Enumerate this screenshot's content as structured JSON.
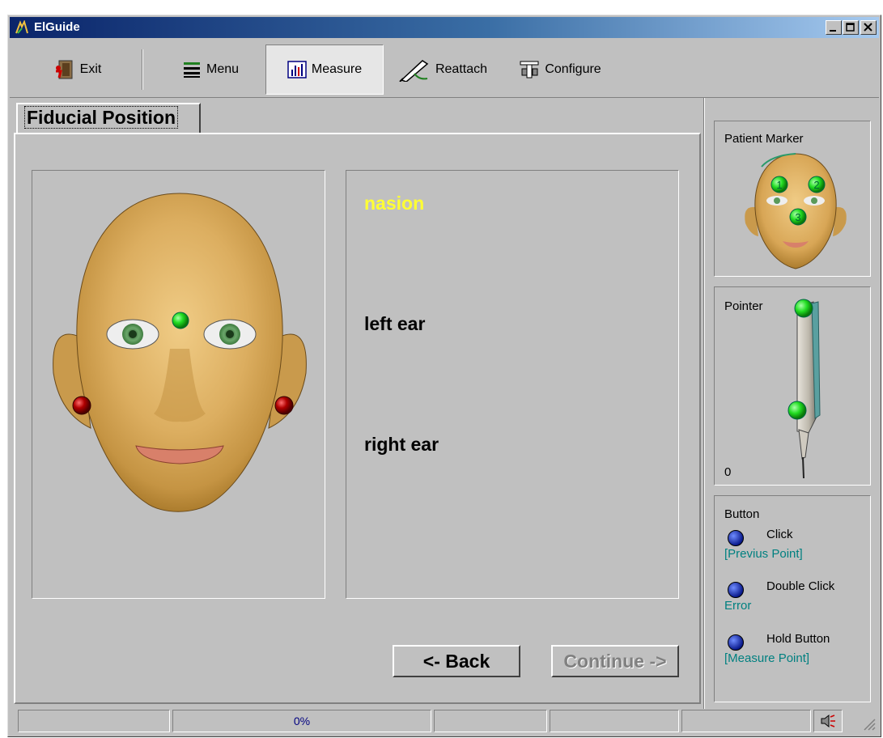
{
  "window": {
    "title": "ElGuide"
  },
  "toolbar": {
    "exit_label": "Exit",
    "menu_label": "Menu",
    "measure_label": "Measure",
    "reattach_label": "Reattach",
    "configure_label": "Configure"
  },
  "tab": {
    "label": "Fiducial Position"
  },
  "fiducials": {
    "items": [
      "nasion",
      "left ear",
      "right ear"
    ],
    "current": "nasion"
  },
  "buttons": {
    "back_label": "<- Back",
    "continue_label": "Continue ->"
  },
  "side": {
    "patient_marker_label": "Patient Marker",
    "pointer_label": "Pointer",
    "pointer_value": "0",
    "marker_numbers": [
      "1",
      "2",
      "3"
    ],
    "button_label": "Button",
    "click_label": "Click",
    "click_action": "[Previus Point]",
    "double_click_label": "Double Click",
    "double_click_action": "Error",
    "hold_label": "Hold Button",
    "hold_action": "[Measure Point]"
  },
  "status": {
    "progress_text": "0%"
  },
  "colors": {
    "titlebar": "#0a246a",
    "current_fiducial": "#ffff33",
    "marker_green": "#33dd33",
    "ear_marker_red": "#8b0000",
    "action_text": "#008080"
  }
}
